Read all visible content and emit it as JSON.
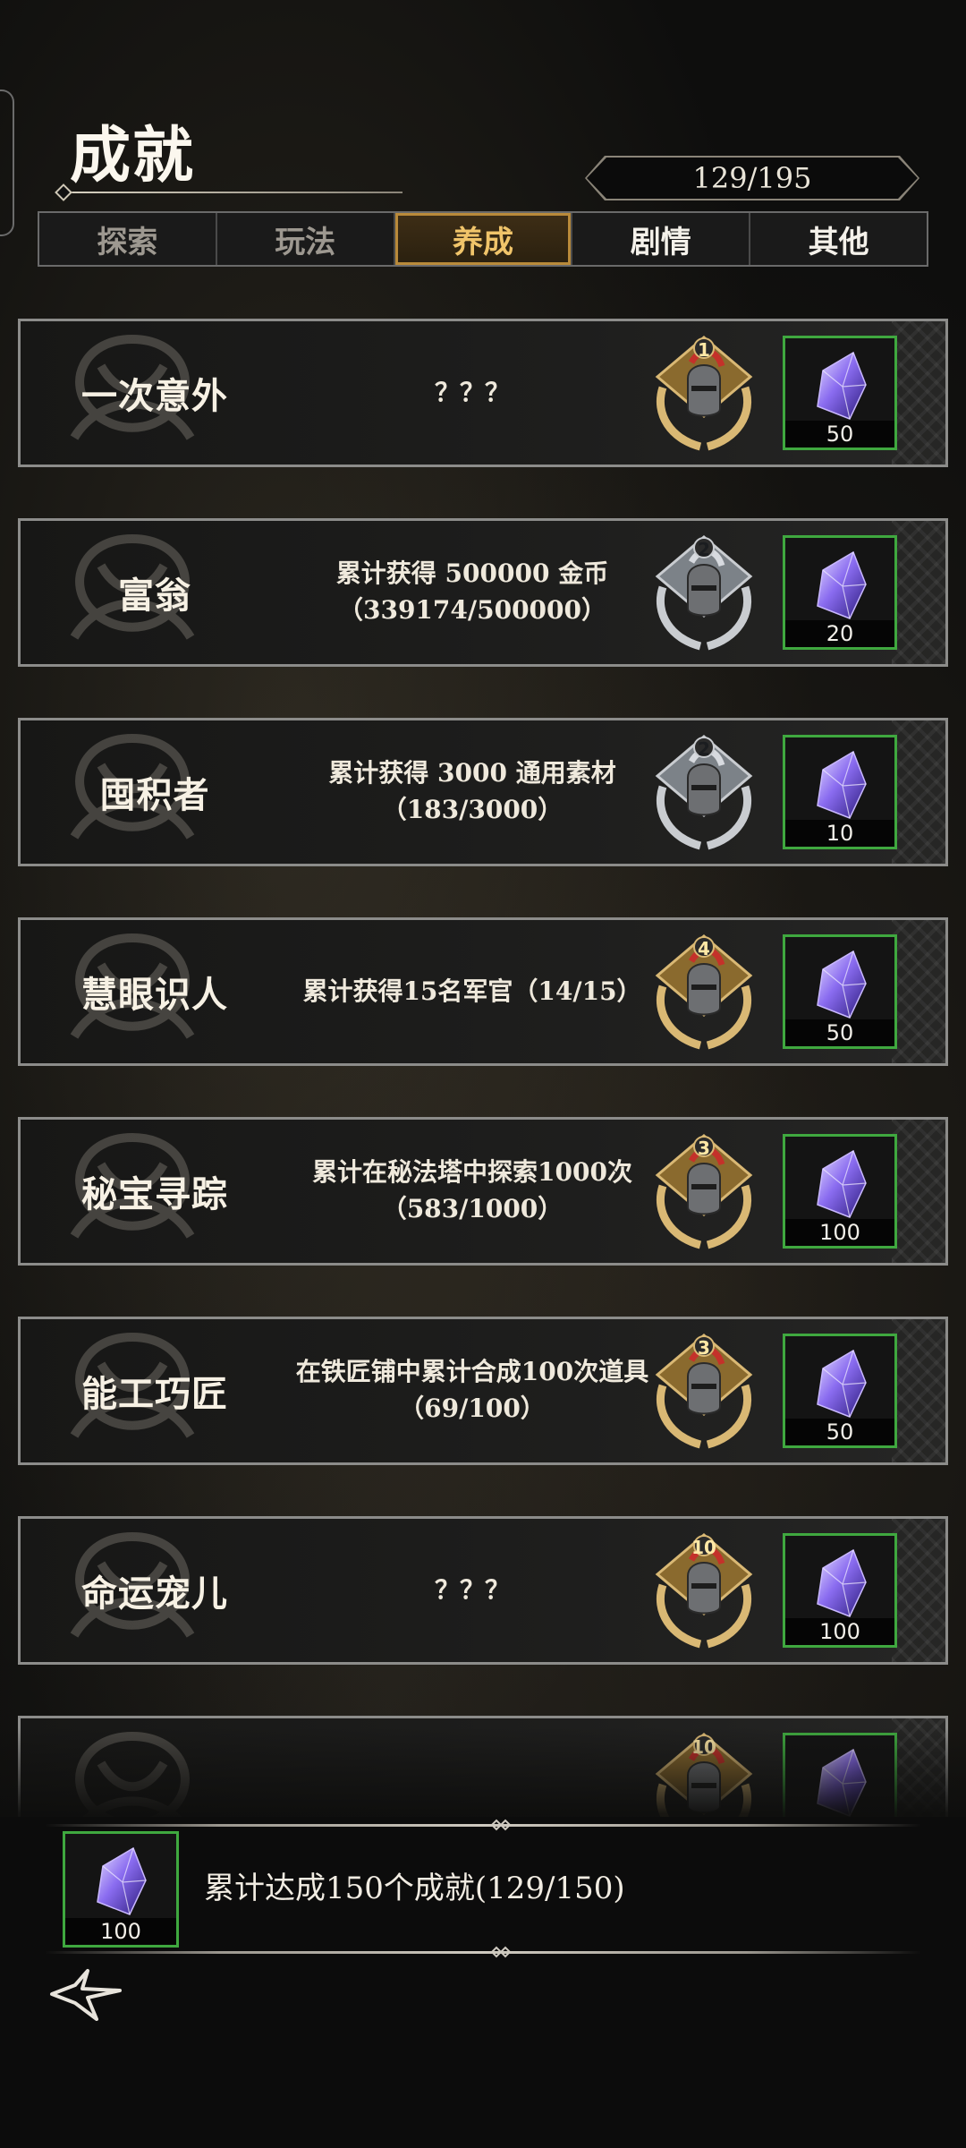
{
  "header": {
    "title": "成就",
    "progress": "129/195"
  },
  "tabs": [
    {
      "label": "探索",
      "active": false
    },
    {
      "label": "玩法",
      "active": false
    },
    {
      "label": "养成",
      "active": true
    },
    {
      "label": "剧情",
      "active": false
    },
    {
      "label": "其他",
      "active": false
    }
  ],
  "achievements": [
    {
      "name": "一次意外",
      "desc_line1": "？？？",
      "desc_line2": "",
      "badge_level": "1",
      "badge_tier": "gold",
      "reward_icon": "purple-crystal-icon",
      "reward_amount": "50"
    },
    {
      "name": "富翁",
      "desc_line1": "累计获得 500000 金币",
      "desc_line2": "（339174/500000）",
      "badge_level": "2",
      "badge_tier": "silver",
      "reward_icon": "purple-crystal-icon",
      "reward_amount": "20"
    },
    {
      "name": "囤积者",
      "desc_line1": "累计获得 3000 通用素材",
      "desc_line2": "（183/3000）",
      "badge_level": "2",
      "badge_tier": "silver",
      "reward_icon": "purple-crystal-icon",
      "reward_amount": "10"
    },
    {
      "name": "慧眼识人",
      "desc_line1": "累计获得15名军官（14/15）",
      "desc_line2": "",
      "badge_level": "4",
      "badge_tier": "gold",
      "reward_icon": "purple-crystal-icon",
      "reward_amount": "50"
    },
    {
      "name": "秘宝寻踪",
      "desc_line1": "累计在秘法塔中探索1000次",
      "desc_line2": "（583/1000）",
      "badge_level": "3",
      "badge_tier": "gold",
      "reward_icon": "purple-crystal-icon",
      "reward_amount": "100"
    },
    {
      "name": "能工巧匠",
      "desc_line1": "在铁匠铺中累计合成100次道具",
      "desc_line2": "（69/100）",
      "badge_level": "3",
      "badge_tier": "gold",
      "reward_icon": "purple-crystal-icon",
      "reward_amount": "50"
    },
    {
      "name": "命运宠儿",
      "desc_line1": "？？？",
      "desc_line2": "",
      "badge_level": "10",
      "badge_tier": "gold",
      "reward_icon": "purple-crystal-icon",
      "reward_amount": "100"
    },
    {
      "name": "",
      "desc_line1": "",
      "desc_line2": "",
      "badge_level": "10",
      "badge_tier": "gold",
      "reward_icon": "purple-crystal-icon",
      "reward_amount": ""
    }
  ],
  "bottom": {
    "reward_icon": "purple-crystal-icon",
    "reward_amount": "100",
    "goal_text": "累计达成150个成就(129/150)"
  },
  "colors": {
    "accent_gold": "#f0c46a",
    "reward_border": "#3fa83f"
  }
}
